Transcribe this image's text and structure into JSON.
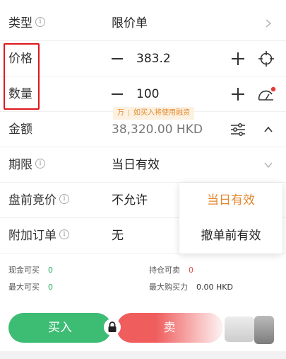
{
  "order_type": {
    "label": "类型",
    "value": "限价单"
  },
  "price": {
    "label": "价格",
    "value": "383.2"
  },
  "quantity": {
    "label": "数量",
    "value": "100"
  },
  "hint": {
    "unit": "万",
    "text": "如买入将使用融资"
  },
  "amount": {
    "label": "金额",
    "value": "38,320.00 HKD"
  },
  "validity": {
    "label": "期限",
    "value": "当日有效"
  },
  "premarket": {
    "label": "盘前竞价",
    "value": "不允许"
  },
  "attached_order": {
    "label": "附加订单",
    "value": "无"
  },
  "validity_options": {
    "selected": "当日有效",
    "other": "撤单前有效"
  },
  "stats": {
    "cash_buy_label": "现金可买",
    "cash_buy_value": "0",
    "position_sell_label": "持仓可卖",
    "position_sell_value": "0",
    "max_buy_label": "最大可买",
    "max_buy_value": "0",
    "max_power_label": "最大购买力",
    "max_power_value": "0.00 HKD"
  },
  "actions": {
    "buy": "买入",
    "sell": "卖"
  },
  "colors": {
    "buy": "#3dbd74",
    "sell": "#ef5d5d",
    "accent": "#e4872d",
    "highlight": "#e0171a"
  }
}
